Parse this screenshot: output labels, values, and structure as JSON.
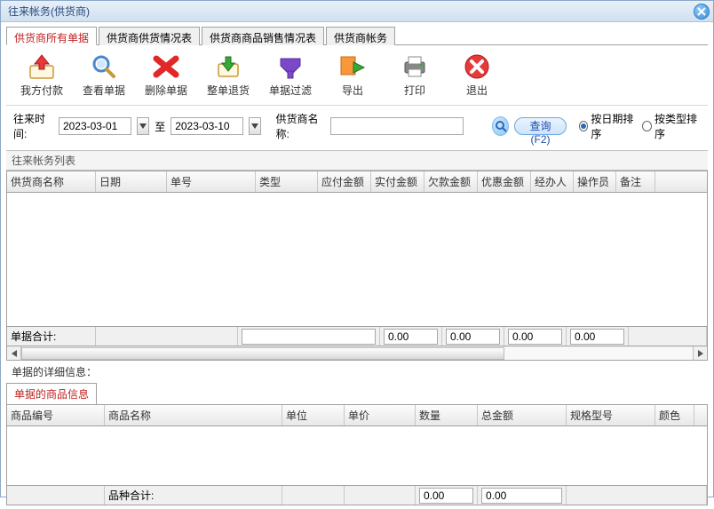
{
  "window": {
    "title": "往来帐务(供货商)"
  },
  "tabs": [
    "供货商所有单据",
    "供货商供货情况表",
    "供货商商品销售情况表",
    "供货商帐务"
  ],
  "active_tab": 0,
  "toolbar": [
    {
      "id": "pay",
      "label": "我方付款"
    },
    {
      "id": "view",
      "label": "查看单据"
    },
    {
      "id": "delete",
      "label": "删除单据"
    },
    {
      "id": "return",
      "label": "整单退货"
    },
    {
      "id": "filter",
      "label": "单据过滤"
    },
    {
      "id": "export",
      "label": "导出"
    },
    {
      "id": "print",
      "label": "打印"
    },
    {
      "id": "exit",
      "label": "退出"
    }
  ],
  "filter": {
    "time_label": "往来时间:",
    "date_from": "2023-03-01",
    "to_label": "至",
    "date_to": "2023-03-10",
    "supplier_label": "供货商名称:",
    "supplier_value": "",
    "query_btn": "查询(F2)",
    "sort_by_date": "按日期排序",
    "sort_by_type": "按类型排序",
    "sort_selected": "date"
  },
  "list_group_label": "往来帐务列表",
  "grid1_cols": [
    "供货商名称",
    "日期",
    "单号",
    "类型",
    "应付金额",
    "实付金额",
    "欠款金额",
    "优惠金额",
    "经办人",
    "操作员",
    "备注"
  ],
  "grid1_widths": [
    100,
    80,
    100,
    70,
    60,
    60,
    60,
    60,
    48,
    48,
    44
  ],
  "totals": {
    "label": "单据合计:",
    "blank": "",
    "v1": "0.00",
    "v2": "0.00",
    "v3": "0.00",
    "v4": "0.00"
  },
  "detail_label": "单据的详细信息：",
  "subtab": "单据的商品信息",
  "grid2_cols": [
    "商品编号",
    "商品名称",
    "单位",
    "单价",
    "数量",
    "总金额",
    "规格型号",
    "颜色"
  ],
  "grid2_widths": [
    110,
    200,
    70,
    80,
    70,
    100,
    100,
    44
  ],
  "totals2": {
    "label": "品种合计:",
    "v1": "0.00",
    "v2": "0.00"
  }
}
